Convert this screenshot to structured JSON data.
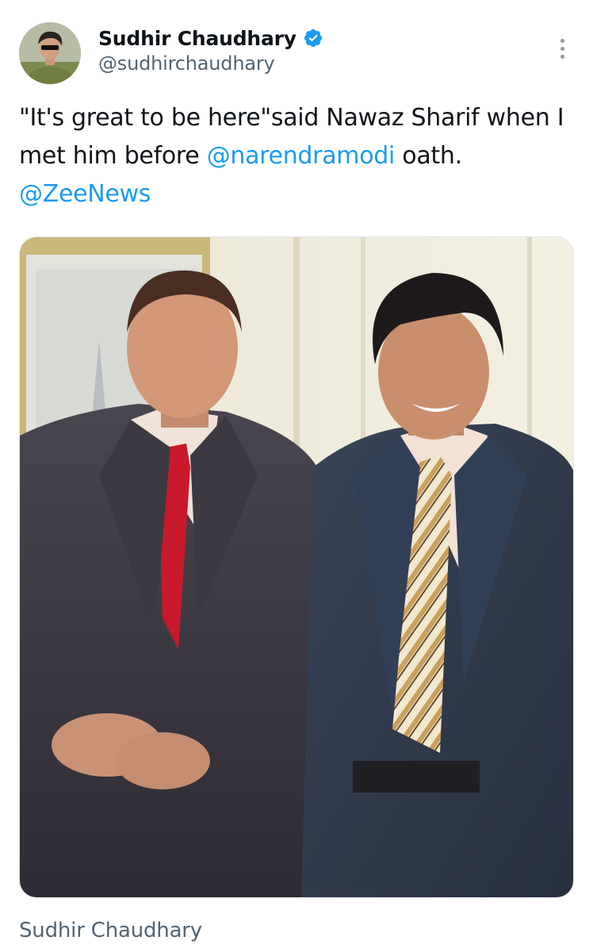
{
  "author": {
    "display_name": "Sudhir Chaudhary",
    "handle": "@sudhirchaudhary",
    "verified": true,
    "verified_badge_color": "#1d9bf0"
  },
  "tweet": {
    "text_before": "\"It's great to be here\"said Nawaz Sharif when I met him before ",
    "mention_1": "@narendramodi",
    "text_middle": " oath. ",
    "mention_2": "@ZeeNews",
    "mention_color": "#1d9bf0"
  },
  "media": {
    "alt": "Two men in suits posing together indoors"
  },
  "footer": {
    "name": "Sudhir Chaudhary"
  },
  "icons": {
    "more": "more-vertical-icon",
    "verified": "verified-badge-icon"
  }
}
